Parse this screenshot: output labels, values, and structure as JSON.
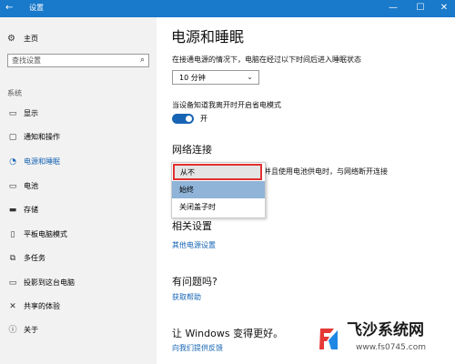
{
  "window": {
    "title": "设置",
    "back_icon": "←",
    "controls": [
      "—",
      "☐",
      "✕"
    ]
  },
  "sidebar": {
    "home_icon": "⚙",
    "home_label": "主页",
    "search_placeholder": "查找设置",
    "search_icon": "⌕",
    "section_label": "系统",
    "items": [
      {
        "icon": "▭",
        "label": "显示"
      },
      {
        "icon": "▢",
        "label": "通知和操作"
      },
      {
        "icon": "◔",
        "label": "电源和睡眠"
      },
      {
        "icon": "▭",
        "label": "电池"
      },
      {
        "icon": "▬",
        "label": "存储"
      },
      {
        "icon": "▯",
        "label": "平板电脑模式"
      },
      {
        "icon": "⧉",
        "label": "多任务"
      },
      {
        "icon": "▭",
        "label": "投影到这台电脑"
      },
      {
        "icon": "✕",
        "label": "共享的体验"
      },
      {
        "icon": "ⓘ",
        "label": "关于"
      }
    ],
    "active_index": 2
  },
  "main": {
    "title": "电源和睡眠",
    "sleep_desc": "在接通电源的情况下，电脑在经过以下时间后进入睡眠状态",
    "sleep_value": "10 分钟",
    "sleep_arrow": "⌄",
    "away_desc": "当设备知道我离开时开启省电模式",
    "toggle_label": "开",
    "network_title": "网络连接",
    "network_tail": "并且使用电池供电时，与网络断开连接",
    "network_options": [
      "从不",
      "始终",
      "关闭盖子时"
    ],
    "related_title": "相关设置",
    "related_link": "其他电源设置",
    "question_title": "有问题吗?",
    "question_link": "获取帮助",
    "improve_title": "让 Windows 变得更好。",
    "improve_link": "向我们提供反馈"
  },
  "watermark": {
    "name": "飞沙系统网",
    "url": "www.fs0745.com"
  }
}
